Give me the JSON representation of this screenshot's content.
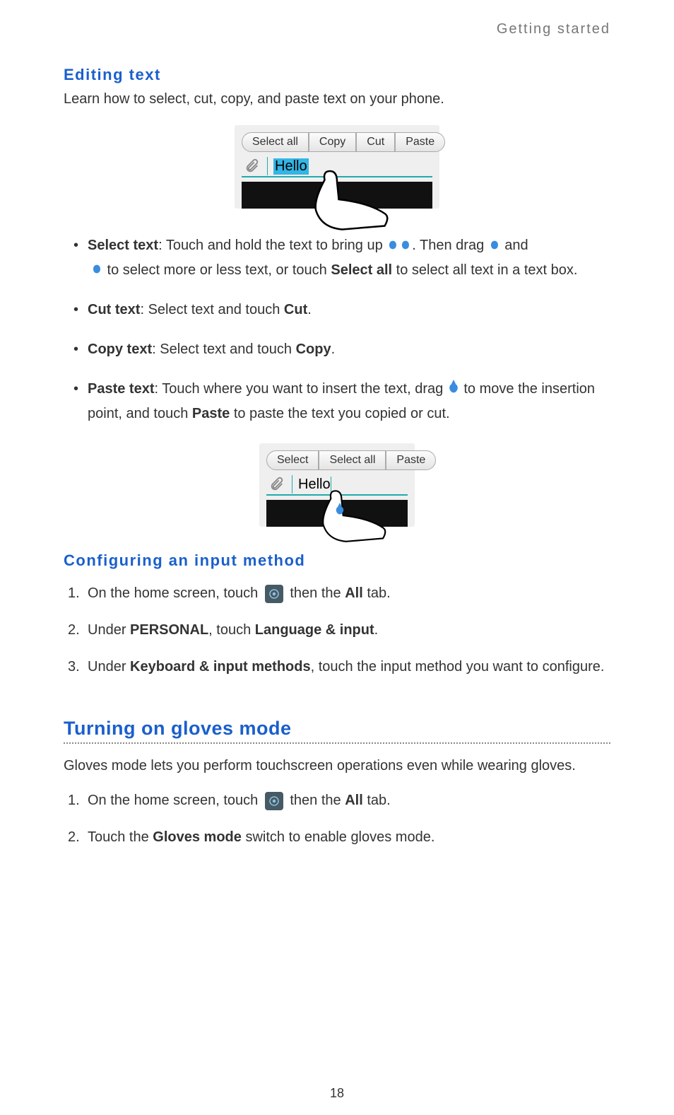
{
  "runningHeader": "Getting started",
  "section1": {
    "title": "Editing text",
    "intro": "Learn how to select, cut, copy, and paste text on your phone.",
    "fig1": {
      "buttons": [
        "Select all",
        "Copy",
        "Cut",
        "Paste"
      ],
      "inputText": "Hello"
    },
    "bullets": {
      "selectText": {
        "leadBold": "Select text",
        "part1": ": Touch and hold the text to bring up ",
        "part2": ". Then drag ",
        "part3": " and ",
        "part4": " to select more or less text, or touch ",
        "selectAll": "Select all",
        "part5": " to select all text in a text box."
      },
      "cutText": {
        "leadBold": "Cut text",
        "part1": ": Select text and touch ",
        "action": "Cut",
        "end": "."
      },
      "copyText": {
        "leadBold": "Copy text",
        "part1": ": Select text and touch ",
        "action": "Copy",
        "end": "."
      },
      "pasteText": {
        "leadBold": "Paste text",
        "part1": ": Touch where you want to insert the text, drag ",
        "part2": " to move the insertion point, and touch ",
        "action": "Paste",
        "part3": " to paste the text you copied or cut."
      }
    },
    "fig2": {
      "buttons": [
        "Select",
        "Select all",
        "Paste"
      ],
      "inputText": "Hello"
    }
  },
  "section2": {
    "title": "Configuring an input method",
    "step1": {
      "pre": "On the home screen, touch ",
      "post": " then the ",
      "bold": "All",
      "end": " tab."
    },
    "step2": {
      "pre": "Under ",
      "b1": "PERSONAL",
      "mid": ", touch ",
      "b2": "Language & input",
      "end": "."
    },
    "step3": {
      "pre": "Under ",
      "b1": "Keyboard & input methods",
      "post": ", touch the input method you want to configure."
    }
  },
  "section3": {
    "title": "Turning on gloves mode",
    "intro": "Gloves mode lets you perform touchscreen operations even while wearing gloves.",
    "step1": {
      "pre": "On the home screen, touch ",
      "post": " then the ",
      "bold": "All",
      "end": " tab."
    },
    "step2": {
      "pre": "Touch the ",
      "bold": "Gloves mode",
      "post": " switch to enable gloves mode."
    }
  },
  "pageNumber": "18"
}
